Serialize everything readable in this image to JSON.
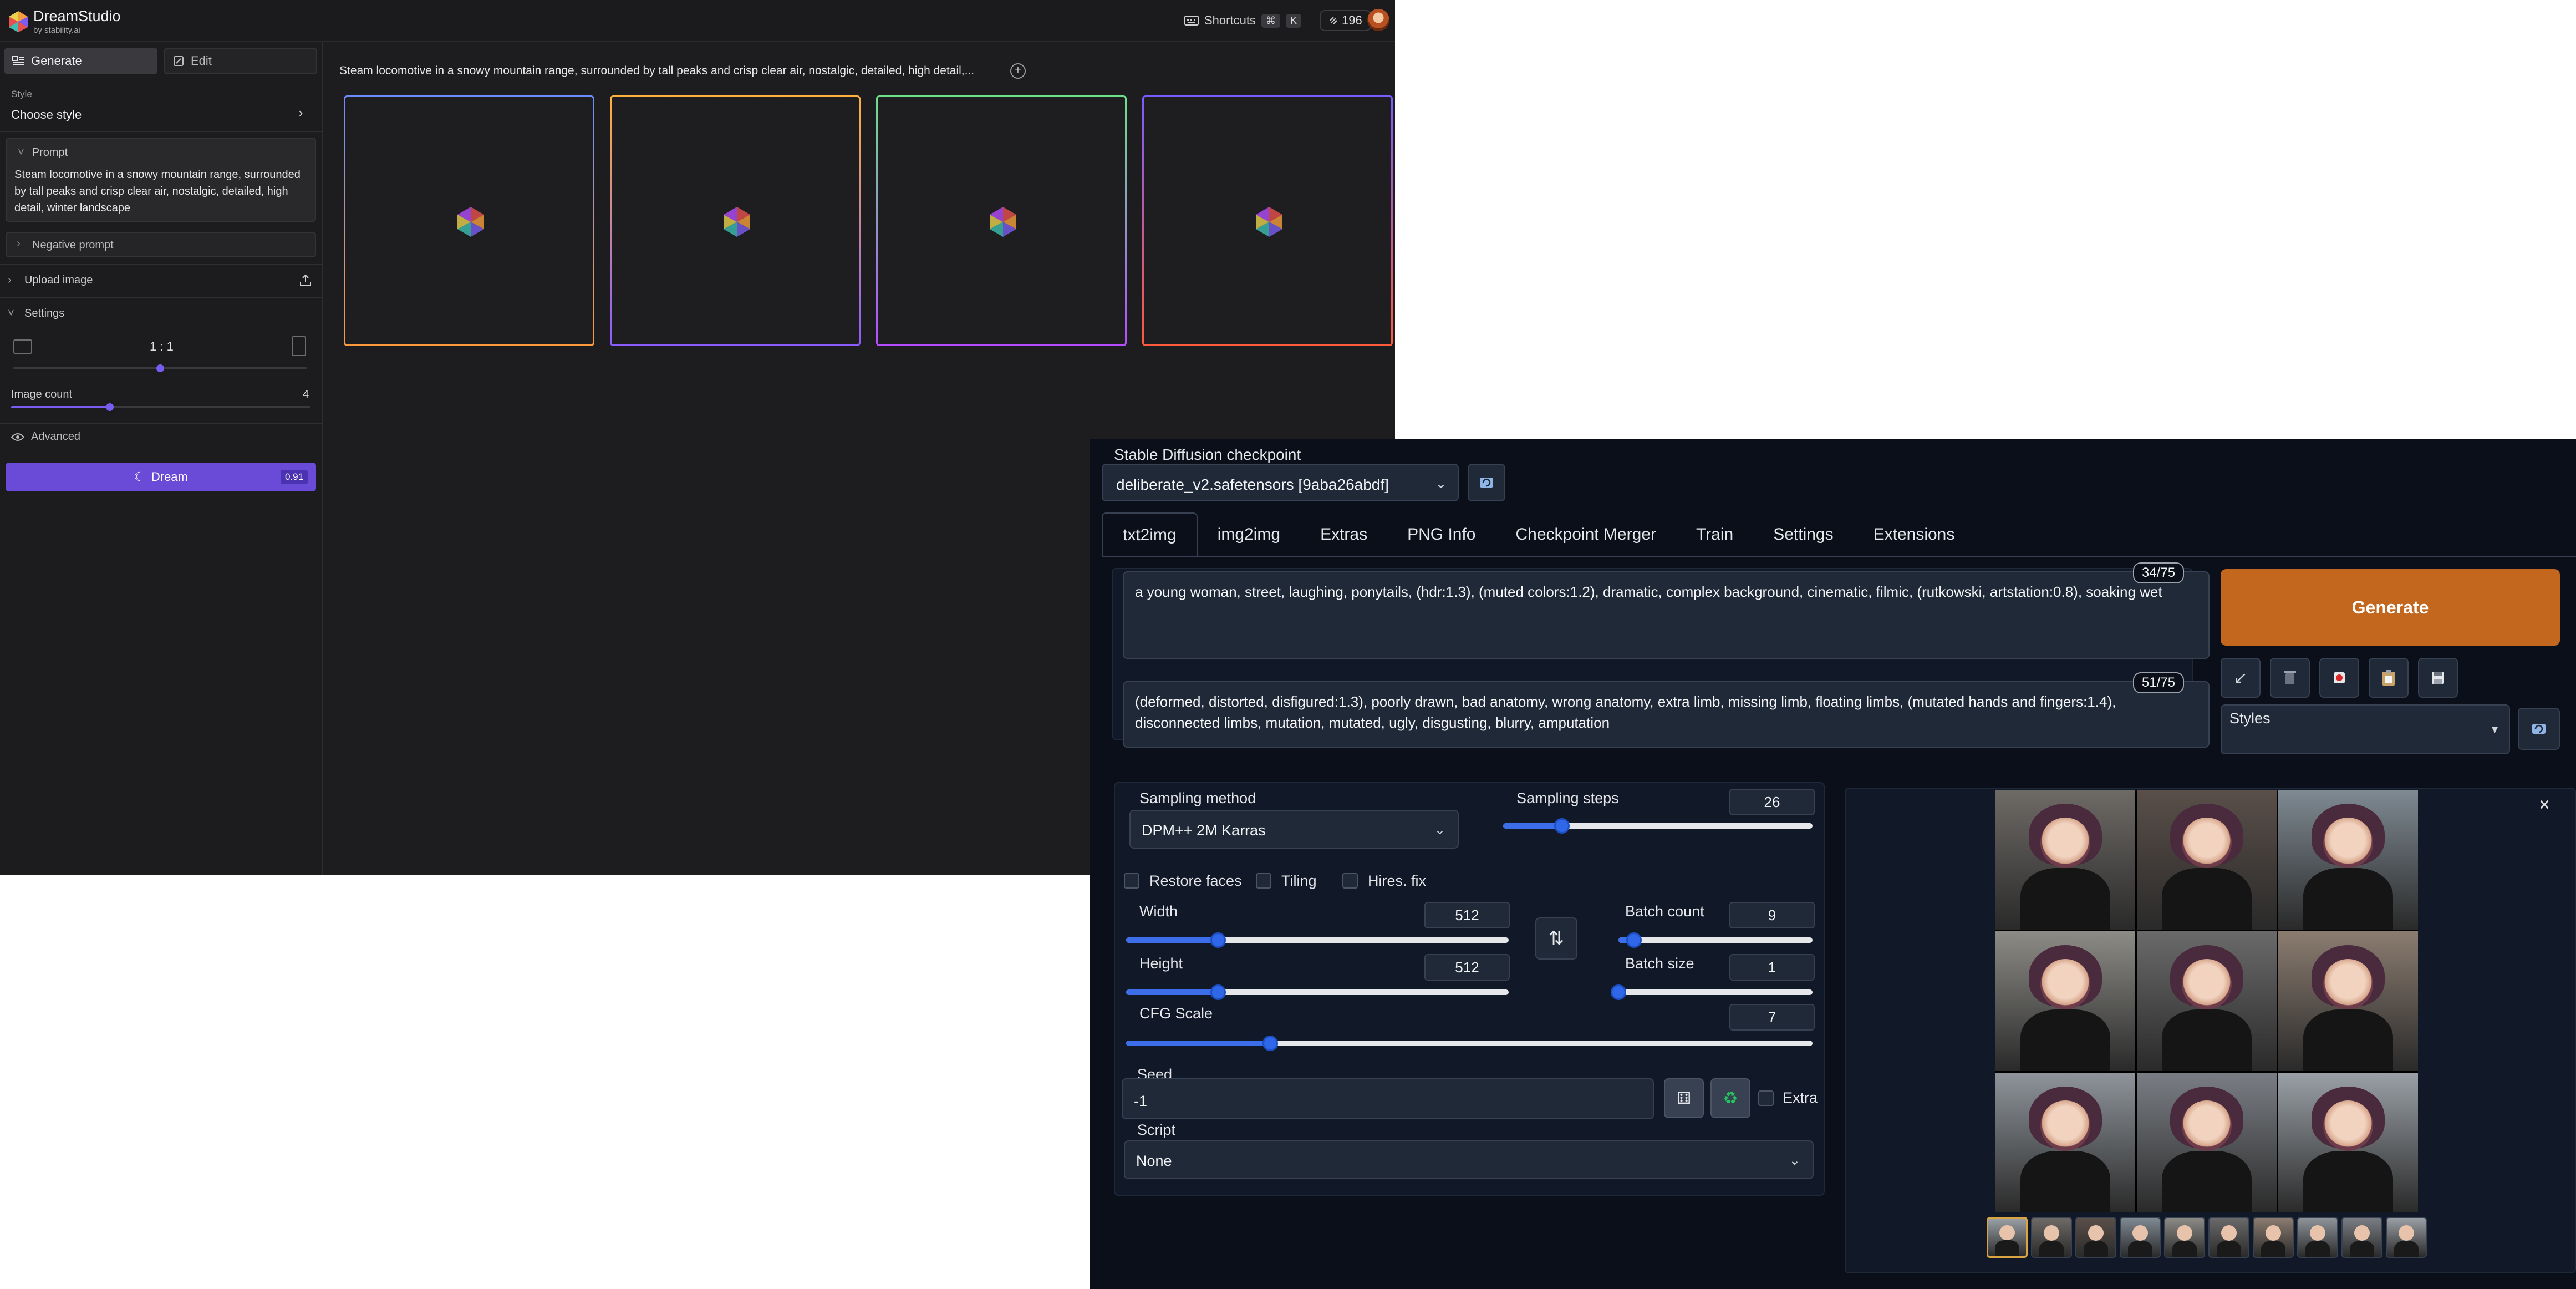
{
  "dreamstudio": {
    "brand": "DreamStudio",
    "brand_sub": "by stability.ai",
    "shortcuts_label": "Shortcuts",
    "shortcut_keys": [
      "⌘",
      "K"
    ],
    "credits": "196",
    "tabs": {
      "generate": "Generate",
      "edit": "Edit"
    },
    "style": {
      "label": "Style",
      "value": "Choose style"
    },
    "prompt": {
      "title": "Prompt",
      "text": "Steam locomotive in a snowy mountain range, surrounded by tall peaks and crisp clear air, nostalgic, detailed, high detail, winter landscape"
    },
    "negative_prompt": "Negative prompt",
    "upload_image": "Upload image",
    "settings": "Settings",
    "aspect_ratio": "1 : 1",
    "aspect_slider": 0.5,
    "image_count": {
      "label": "Image count",
      "value": "4",
      "slider": 0.33
    },
    "advanced": "Advanced",
    "dream": {
      "label": "Dream",
      "cost": "0.91"
    },
    "main_prompt": "Steam locomotive in a snowy mountain range, surrounded by tall peaks and crisp clear air, nostalgic, detailed, high detail,...",
    "image_borders": [
      [
        "#6b8cff",
        "#ff9a3c"
      ],
      [
        "#ffb13c",
        "#8a5cff"
      ],
      [
        "#6ee08a",
        "#b44cff"
      ],
      [
        "#7a5cff",
        "#ff5a3c"
      ]
    ]
  },
  "sd": {
    "checkpoint": {
      "label": "Stable Diffusion checkpoint",
      "value": "deliberate_v2.safetensors [9aba26abdf]"
    },
    "tabs": [
      "txt2img",
      "img2img",
      "Extras",
      "PNG Info",
      "Checkpoint Merger",
      "Train",
      "Settings",
      "Extensions"
    ],
    "prompt": {
      "text": "a young woman, street, laughing, ponytails, (hdr:1.3), (muted colors:1.2), dramatic, complex background, cinematic, filmic, (rutkowski, artstation:0.8), soaking wet",
      "tokens": "34/75"
    },
    "negative": {
      "text": "(deformed, distorted, disfigured:1.3), poorly drawn, bad anatomy, wrong anatomy, extra limb, missing limb, floating limbs, (mutated hands and fingers:1.4), disconnected limbs, mutation, mutated, ugly, disgusting, blurry, amputation",
      "tokens": "51/75"
    },
    "generate": "Generate",
    "styles_label": "Styles",
    "sampling_method": {
      "label": "Sampling method",
      "value": "DPM++ 2M Karras"
    },
    "sampling_steps": {
      "label": "Sampling steps",
      "value": "26",
      "fraction": 0.19
    },
    "checkboxes": {
      "restore_faces": "Restore faces",
      "tiling": "Tiling",
      "hires_fix": "Hires. fix"
    },
    "width": {
      "label": "Width",
      "value": "512",
      "fraction": 0.24
    },
    "height": {
      "label": "Height",
      "value": "512",
      "fraction": 0.24
    },
    "batch_count": {
      "label": "Batch count",
      "value": "9",
      "fraction": 0.08
    },
    "batch_size": {
      "label": "Batch size",
      "value": "1",
      "fraction": 0.0
    },
    "cfg_scale": {
      "label": "CFG Scale",
      "value": "7",
      "fraction": 0.21
    },
    "seed": {
      "label": "Seed",
      "value": "-1"
    },
    "extra": "Extra",
    "script": {
      "label": "Script",
      "value": "None"
    },
    "icons": {
      "refresh": "refresh-icon",
      "arrow": "arrow-down-left-icon",
      "trash": "trash-icon",
      "record": "record-icon",
      "clipboard": "clipboard-icon",
      "save": "save-icon",
      "swap": "swap-icon",
      "dice": "dice-icon",
      "recycle": "recycle-icon",
      "close": "close-icon"
    },
    "colors": {
      "generate": "#c2671d",
      "slider": "#3b6ee8",
      "bg": "#0b0f19"
    },
    "gallery_backgrounds": [
      "#6e6a66",
      "#5a4f49",
      "#7f8a93",
      "#8c8b86",
      "#6a6a6a",
      "#8b7c70",
      "#8e949a",
      "#7a7e84",
      "#9aa0a6"
    ]
  }
}
